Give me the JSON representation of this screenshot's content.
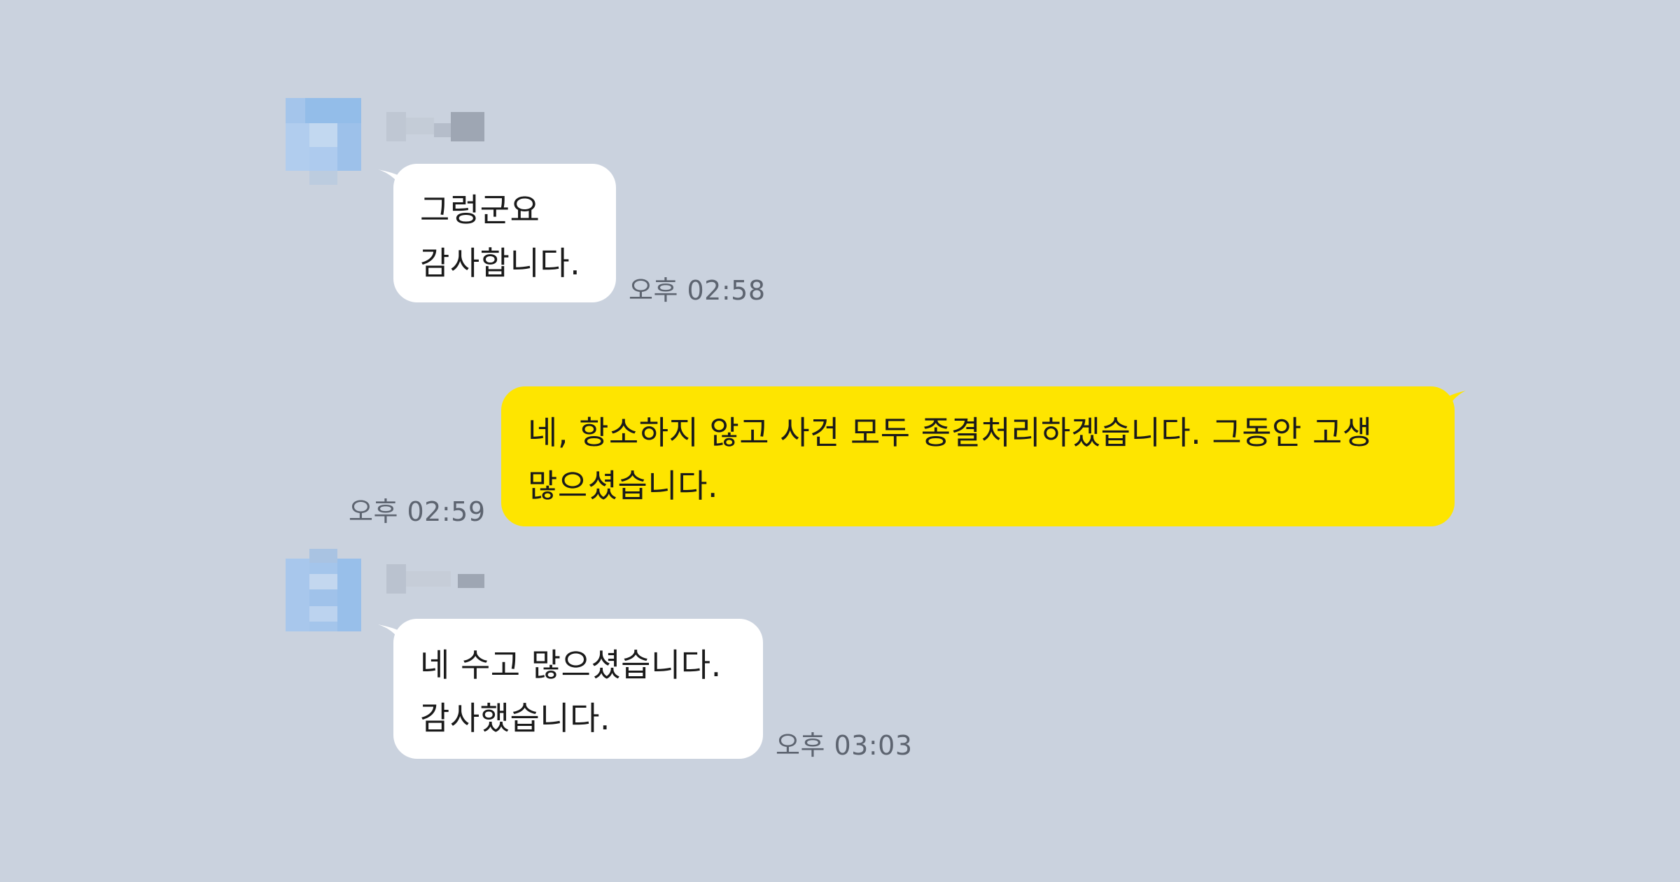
{
  "chat": {
    "messages": [
      {
        "direction": "incoming",
        "lines": [
          "그렁군요",
          "감사합니다."
        ],
        "time": "오후 02:58"
      },
      {
        "direction": "outgoing",
        "lines": [
          "네, 항소하지 않고 사건 모두 종결처리하겠습니다. 그동안 고생",
          "많으셨습니다."
        ],
        "time": "오후 02:59"
      },
      {
        "direction": "incoming",
        "lines": [
          "네 수고 많으셨습니다.",
          "감사했습니다."
        ],
        "time": "오후 03:03"
      }
    ]
  },
  "colors": {
    "background": "#cad2de",
    "incoming_bubble": "#ffffff",
    "outgoing_bubble": "#fee500",
    "timestamp": "#5d6470",
    "avatar_blur": "#9fc3ea"
  }
}
